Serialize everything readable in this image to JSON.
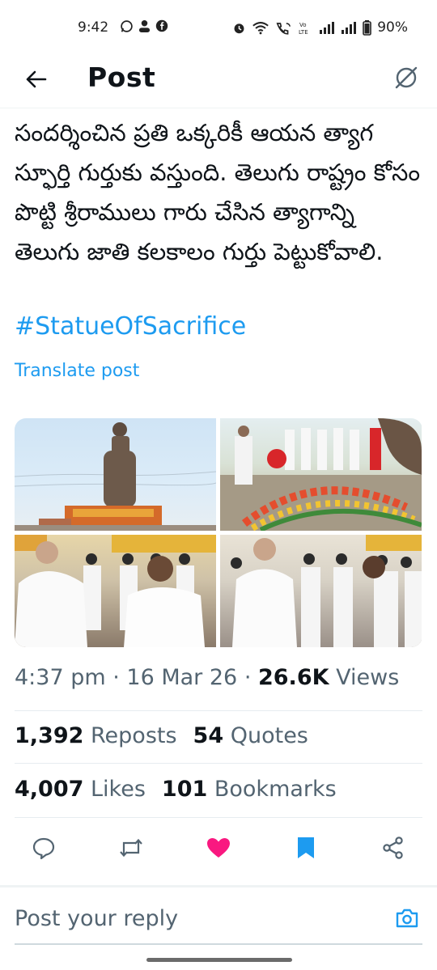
{
  "status_bar": {
    "time": "9:42",
    "left_icons": [
      "whatsapp-icon",
      "person-icon",
      "facebook-icon"
    ],
    "right_icons": [
      "alarm-icon",
      "wifi-icon",
      "wifi-calling-icon",
      "volte-icon",
      "signal-icon",
      "signal-icon",
      "battery-icon"
    ],
    "battery": "90%"
  },
  "header": {
    "title": "Post"
  },
  "post": {
    "text": "సందర్శించిన ప్రతి ఒక్కరికీ ఆయన త్యాగ స్ఫూర్తి గుర్తుకు వస్తుంది. తెలుగు రాష్ట్రం కోసం పొట్టి శ్రీరాములు గారు చేసిన త్యాగాన్ని తెలుగు జాతి కలకాలం గుర్తు పెట్టుకోవాలి.",
    "hashtag": "#StatueOfSacrifice",
    "translate": "Translate post"
  },
  "meta": {
    "time": "4:37 pm",
    "separator": " · ",
    "date": "16 Mar 26",
    "views_count": "26.6K",
    "views_label": "Views"
  },
  "stats": {
    "reposts_count": "1,392",
    "reposts_label": "Reposts",
    "quotes_count": "54",
    "quotes_label": "Quotes",
    "likes_count": "4,007",
    "likes_label": "Likes",
    "bookmarks_count": "101",
    "bookmarks_label": "Bookmarks"
  },
  "actions": [
    "reply-icon",
    "repost-icon",
    "heart-icon",
    "bookmark-icon",
    "share-icon"
  ],
  "colors": {
    "accent": "#1d9bf0",
    "like": "#f91880",
    "text": "#0f1419",
    "muted": "#536471"
  },
  "reply": {
    "placeholder": "Post your reply"
  }
}
